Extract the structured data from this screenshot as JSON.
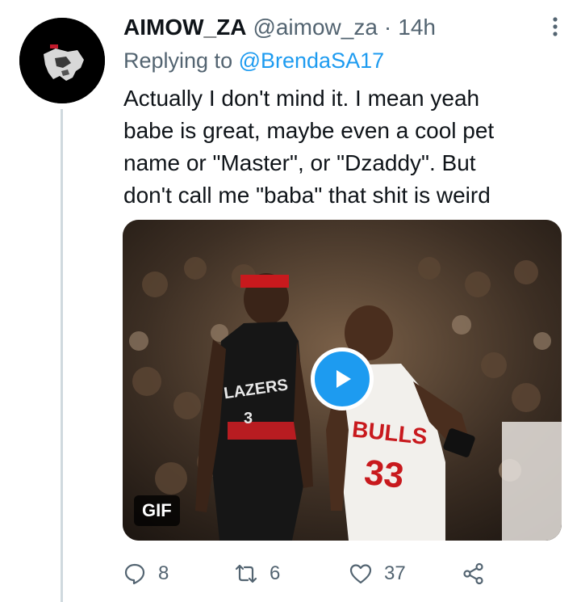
{
  "tweet": {
    "display_name": "AIMOW_ZA",
    "handle": "@aimow_za",
    "separator": "·",
    "time": "14h",
    "replying_prefix": "Replying to ",
    "replying_to": "@BrendaSA17",
    "text": "Actually I don't mind it. I mean yeah\nbabe is great, maybe even a cool pet\nname or \"Master\", or \"Dzaddy\". But\ndon't call me \"baba\" that shit is weird",
    "media": {
      "badge": "GIF",
      "jersey_left": "LAZERS",
      "jersey_left_number": "3",
      "jersey_right": "BULLS",
      "jersey_right_number": "33"
    },
    "actions": {
      "reply_icon": "reply-icon",
      "reply_count": "8",
      "retweet_icon": "retweet-icon",
      "retweet_count": "6",
      "like_icon": "heart-icon",
      "like_count": "37",
      "share_icon": "share-icon"
    }
  },
  "colors": {
    "accent": "#1d9bf0",
    "text": "#0f1419",
    "muted": "#536471",
    "thread_line": "#cfd9de"
  }
}
